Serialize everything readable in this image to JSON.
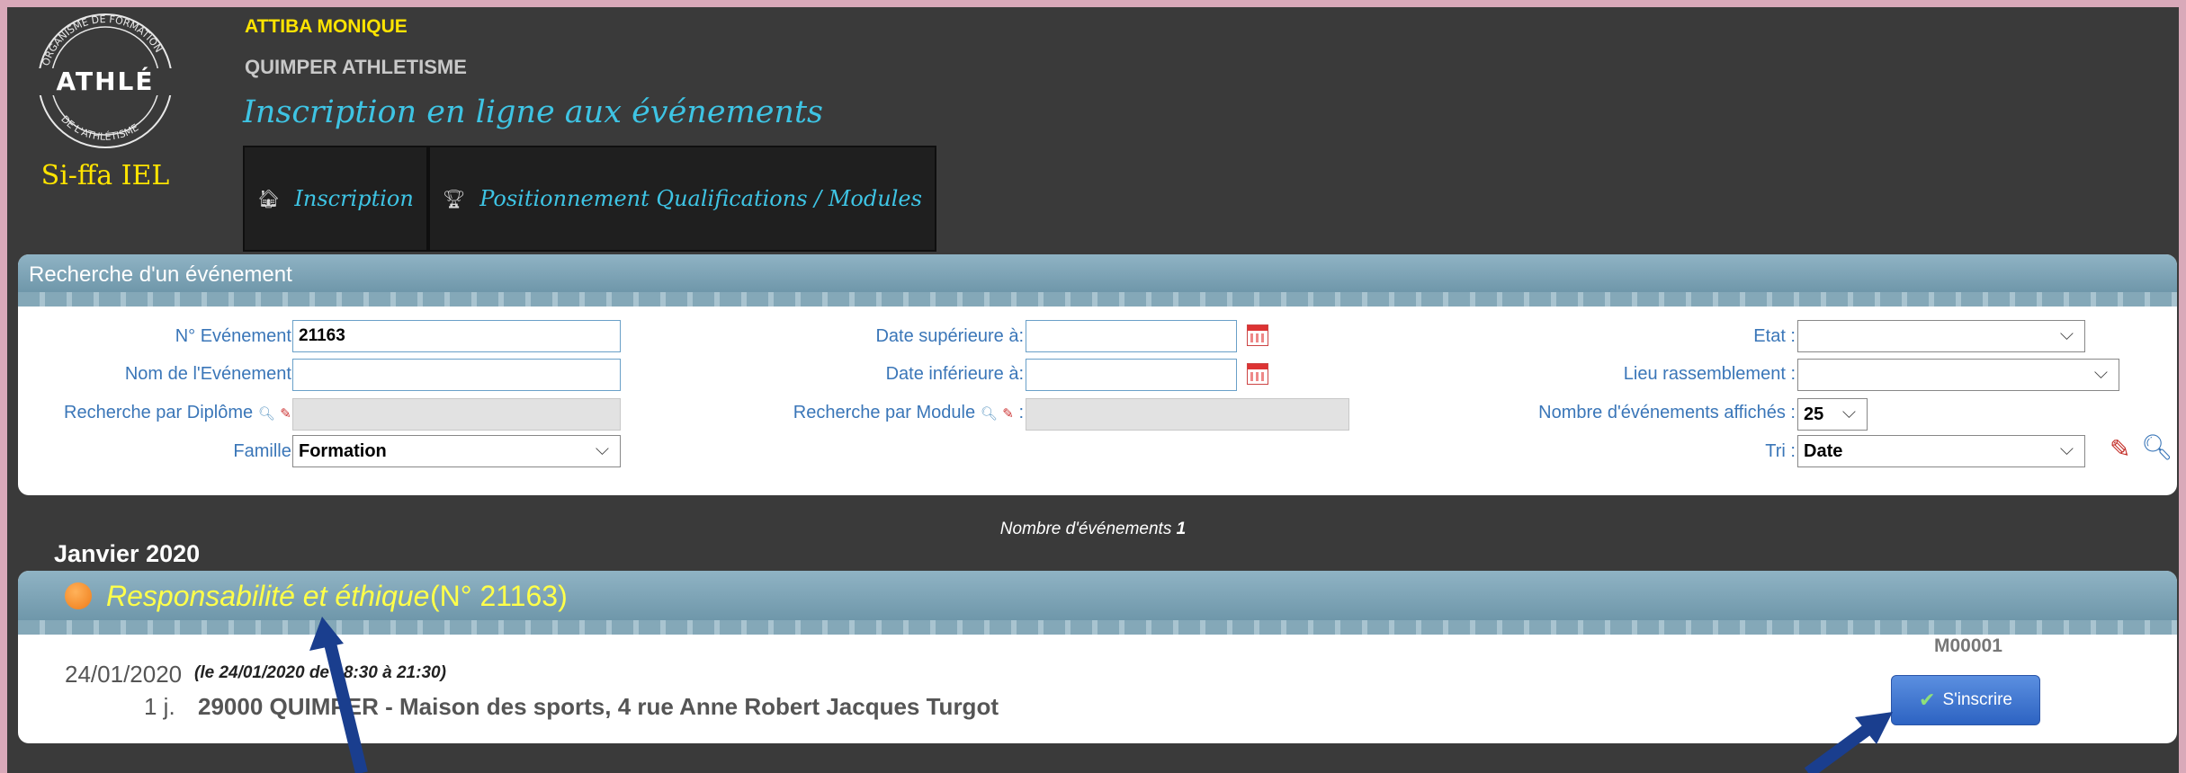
{
  "header": {
    "logo": {
      "ring_text_top": "ORGANISME DE FORMATION",
      "ring_text_bottom": "DE L'ATHLÉTISME",
      "brand": "ATHLÉ",
      "caption": "Si-ffa IEL"
    },
    "user_name": "ATTIBA MONIQUE",
    "club": "QUIMPER ATHLETISME",
    "app_title": "Inscription en ligne aux événements"
  },
  "nav": {
    "items": [
      {
        "icon": "home-icon",
        "label": "Inscription"
      },
      {
        "icon": "trophy-icon",
        "label": "Positionnement Qualifications / Modules"
      }
    ]
  },
  "search": {
    "title": "Recherche d'un événement",
    "fields": {
      "event_no": {
        "label": "N° Evénement :",
        "value": "21163"
      },
      "event_name": {
        "label": "Nom de l'Evénement :",
        "value": ""
      },
      "diploma": {
        "label": "Recherche par Diplôme",
        "value": ""
      },
      "family": {
        "label": "Famille :",
        "value": "Formation"
      },
      "date_after": {
        "label": "Date supérieure à:",
        "value": ""
      },
      "date_before": {
        "label": "Date inférieure à:",
        "value": ""
      },
      "module": {
        "label": "Recherche par Module",
        "value": ""
      },
      "state": {
        "label": "Etat :",
        "value": ""
      },
      "meeting_place": {
        "label": "Lieu rassemblement :",
        "value": ""
      },
      "per_page": {
        "label": "Nombre d'événements affichés :",
        "value": "25"
      },
      "sort": {
        "label": "Tri :",
        "value": "Date"
      }
    },
    "colon": ":"
  },
  "results": {
    "count_label": "Nombre d'événements",
    "count_value": "1",
    "month": "Janvier 2020",
    "event": {
      "title": "Responsabilité et éthique",
      "number": "(N° 21163)",
      "status_color": "#ef7b18",
      "date": "24/01/2020",
      "detail": "(le 24/01/2020 de 18:30 à 21:30)",
      "duration": "1 j.",
      "place": "29000 QUIMPER - Maison des sports, 4 rue Anne Robert Jacques Turgot",
      "module_code": "M00001",
      "register_label": "S'inscrire"
    }
  },
  "colors": {
    "background_frame": "#d9a9b9",
    "page": "#3a3a3a",
    "accent_title": "#3ec4e4",
    "user_yellow": "#ffe400",
    "panel_header": "#7ea5b8",
    "label_blue": "#3a76b8",
    "button_blue": "#2d63c2",
    "arrow_blue": "#1a3e8e"
  }
}
